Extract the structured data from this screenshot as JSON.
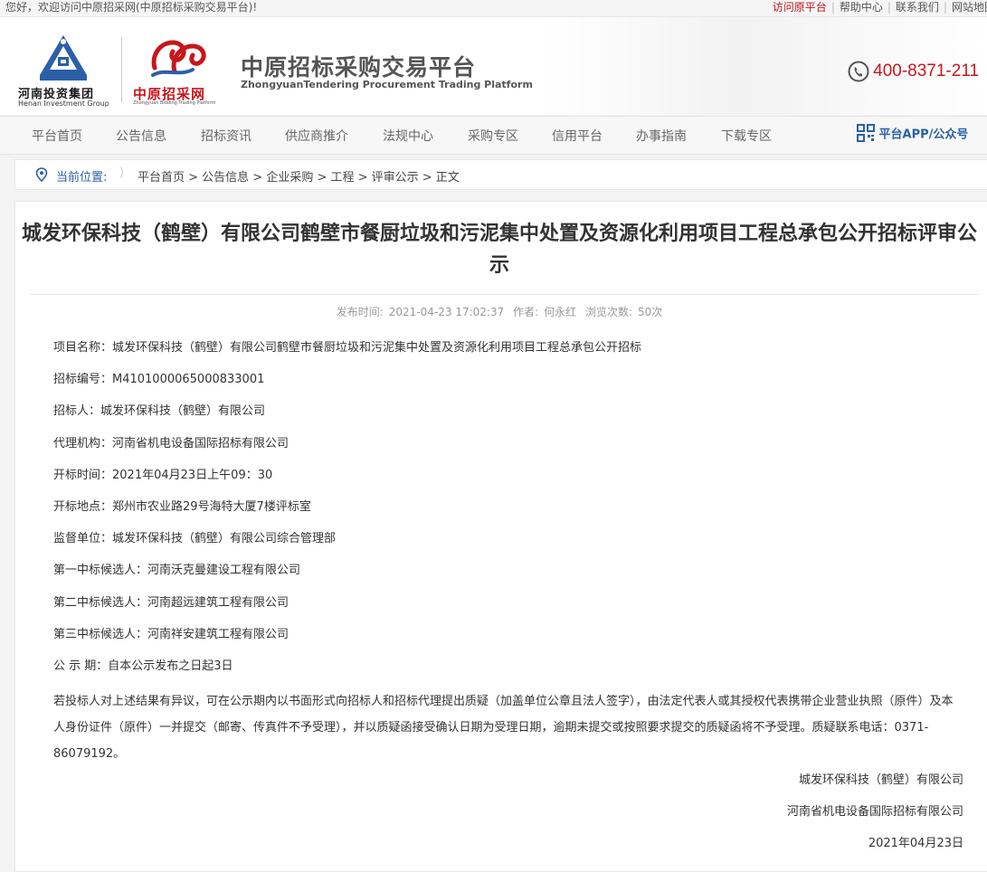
{
  "topbar": {
    "welcome": "您好，欢迎访问中原招采网(中原招标采购交易平台)!",
    "links": [
      "访问原平台",
      "帮助中心",
      "联系我们",
      "网站地图"
    ]
  },
  "header": {
    "group_name": "河南投资集团",
    "group_name_en": "Henan Investment Group",
    "site_name": "中原招采网",
    "site_name_en": "Zhongyuan Bidding Trading Platform",
    "platform_cn": "中原招标采购交易平台",
    "platform_en": "ZhongyuanTendering Procurement Trading Platform",
    "hotline": "400-8371-211"
  },
  "nav": {
    "items": [
      "平台首页",
      "公告信息",
      "招标资讯",
      "供应商推介",
      "法规中心",
      "采购专区",
      "信用平台",
      "办事指南",
      "下载专区"
    ],
    "app_label": "平台APP/公众号"
  },
  "breadcrumb": {
    "label": "当前位置:",
    "path": "平台首页 > 公告信息 > 企业采购 > 工程 > 评审公示 > 正文"
  },
  "article": {
    "title": "城发环保科技（鹤壁）有限公司鹤壁市餐厨垃圾和污泥集中处置及资源化利用项目工程总承包公开招标评审公示",
    "meta": {
      "publish_label": "发布时间:",
      "publish_time": "2021-04-23 17:02:37",
      "author_label": "作者:",
      "author": "何永红",
      "views_label": "浏览次数:",
      "views": "50次"
    },
    "fields": [
      "项目名称：城发环保科技（鹤壁）有限公司鹤壁市餐厨垃圾和污泥集中处置及资源化利用项目工程总承包公开招标",
      "招标编号：M4101000065000833001",
      "招标人：城发环保科技（鹤壁）有限公司",
      "代理机构：河南省机电设备国际招标有限公司",
      "开标时间：2021年04月23日上午09：30",
      "开标地点：郑州市农业路29号海特大厦7楼评标室",
      "监督单位：城发环保科技（鹤壁）有限公司综合管理部",
      "第一中标候选人：河南沃克曼建设工程有限公司",
      "第二中标候选人：河南超远建筑工程有限公司",
      "第三中标候选人：河南祥安建筑工程有限公司",
      "公 示 期：自本公示发布之日起3日"
    ],
    "paragraph": "若投标人对上述结果有异议，可在公示期内以书面形式向招标人和招标代理提出质疑（加盖单位公章且法人签字），由法定代表人或其授权代表携带企业营业执照（原件）及本人身份证件（原件）一并提交（邮寄、传真件不予受理），并以质疑函接受确认日期为受理日期，逾期未提交或按照要求提交的质疑函将不予受理。质疑联系电话：0371-86079192。",
    "signatures": [
      "城发环保科技（鹤壁）有限公司",
      "河南省机电设备国际招标有限公司",
      "2021年04月23日"
    ]
  },
  "colors": {
    "brand_red": "#c8161d",
    "brand_blue": "#2b5fa8"
  }
}
